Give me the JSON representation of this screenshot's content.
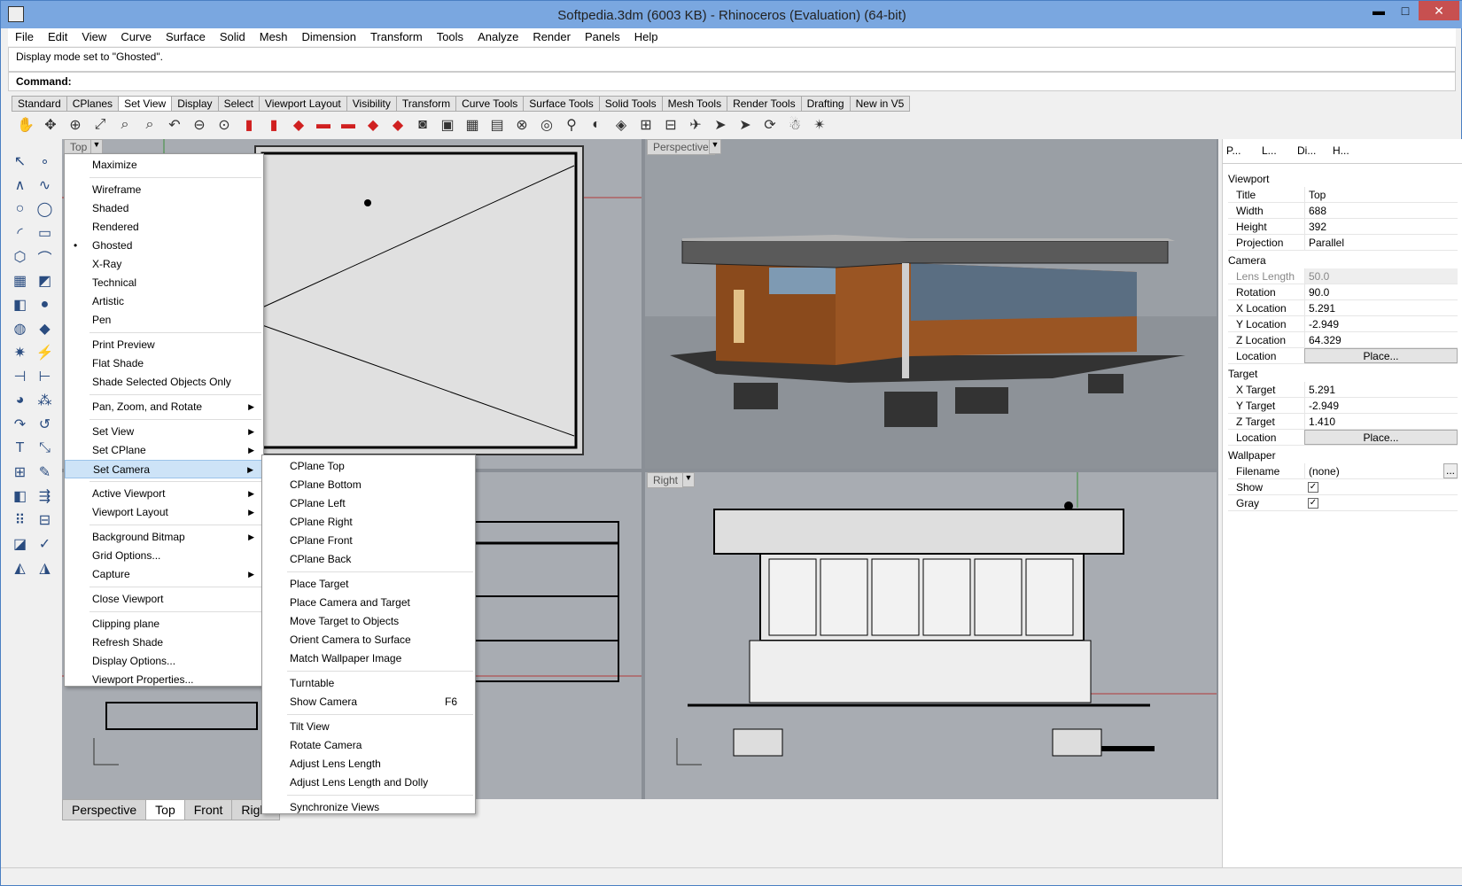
{
  "window": {
    "title": "Softpedia.3dm (6003 KB) - Rhinoceros (Evaluation) (64-bit)",
    "min": "▬",
    "max": "□",
    "close": "✕"
  },
  "menu": [
    "File",
    "Edit",
    "View",
    "Curve",
    "Surface",
    "Solid",
    "Mesh",
    "Dimension",
    "Transform",
    "Tools",
    "Analyze",
    "Render",
    "Panels",
    "Help"
  ],
  "command": {
    "history": "Display mode set to \"Ghosted\".",
    "prompt": "Command:"
  },
  "tabs": [
    "Standard",
    "CPlanes",
    "Set View",
    "Display",
    "Select",
    "Viewport Layout",
    "Visibility",
    "Transform",
    "Curve Tools",
    "Surface Tools",
    "Solid Tools",
    "Mesh Tools",
    "Render Tools",
    "Drafting",
    "New in V5"
  ],
  "viewports": {
    "top": "Top",
    "perspective": "Perspective",
    "right": "Right"
  },
  "bottom_tabs": [
    "Perspective",
    "Top",
    "Front",
    "Right"
  ],
  "context_menu": {
    "maximize": "Maximize",
    "wireframe": "Wireframe",
    "shaded": "Shaded",
    "rendered": "Rendered",
    "ghosted": "Ghosted",
    "xray": "X-Ray",
    "technical": "Technical",
    "artistic": "Artistic",
    "pen": "Pen",
    "print_preview": "Print Preview",
    "flat_shade": "Flat Shade",
    "shade_selected": "Shade Selected Objects Only",
    "pan_zoom": "Pan, Zoom, and Rotate",
    "set_view": "Set View",
    "set_cplane": "Set CPlane",
    "set_camera": "Set Camera",
    "active_viewport": "Active Viewport",
    "viewport_layout": "Viewport Layout",
    "background_bitmap": "Background Bitmap",
    "grid_options": "Grid Options...",
    "capture": "Capture",
    "close_viewport": "Close Viewport",
    "clipping_plane": "Clipping plane",
    "refresh_shade": "Refresh Shade",
    "display_options": "Display Options...",
    "viewport_properties": "Viewport Properties..."
  },
  "submenu": {
    "cplane_top": "CPlane Top",
    "cplane_bottom": "CPlane Bottom",
    "cplane_left": "CPlane Left",
    "cplane_right": "CPlane Right",
    "cplane_front": "CPlane Front",
    "cplane_back": "CPlane Back",
    "place_target": "Place Target",
    "place_camera_target": "Place Camera and Target",
    "move_target": "Move Target to Objects",
    "orient_camera": "Orient Camera to Surface",
    "match_wallpaper": "Match Wallpaper Image",
    "turntable": "Turntable",
    "show_camera": "Show Camera",
    "show_camera_key": "F6",
    "tilt_view": "Tilt View",
    "rotate_camera": "Rotate Camera",
    "adjust_lens": "Adjust Lens Length",
    "adjust_lens_dolly": "Adjust Lens Length and Dolly",
    "sync_views": "Synchronize Views"
  },
  "panel": {
    "tabs": [
      "P...",
      "L...",
      "Di...",
      "H..."
    ],
    "viewport_title": "Viewport",
    "title_k": "Title",
    "title_v": "Top",
    "width_k": "Width",
    "width_v": "688",
    "height_k": "Height",
    "height_v": "392",
    "proj_k": "Projection",
    "proj_v": "Parallel",
    "camera_title": "Camera",
    "lens_k": "Lens Length",
    "lens_v": "50.0",
    "rot_k": "Rotation",
    "rot_v": "90.0",
    "xloc_k": "X Location",
    "xloc_v": "5.291",
    "yloc_k": "Y Location",
    "yloc_v": "-2.949",
    "zloc_k": "Z Location",
    "zloc_v": "64.329",
    "loc_k": "Location",
    "place": "Place...",
    "target_title": "Target",
    "xt_k": "X Target",
    "xt_v": "5.291",
    "yt_k": "Y Target",
    "yt_v": "-2.949",
    "zt_k": "Z Target",
    "zt_v": "1.410",
    "wall_title": "Wallpaper",
    "file_k": "Filename",
    "file_v": "(none)",
    "show_k": "Show",
    "gray_k": "Gray",
    "ellipsis": "..."
  }
}
